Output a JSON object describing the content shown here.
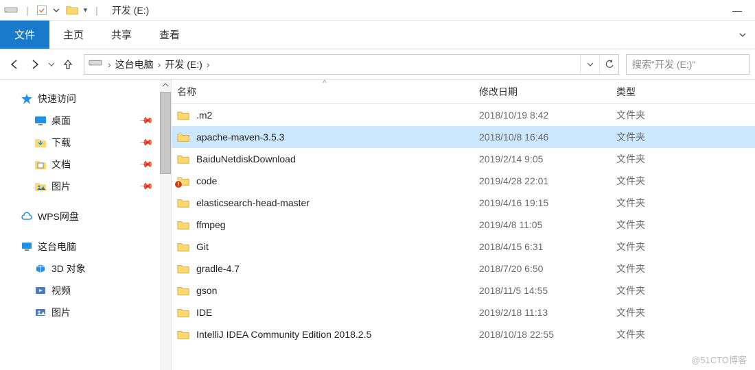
{
  "window": {
    "title": "开发 (E:)",
    "minimize": "—"
  },
  "ribbon": {
    "file": "文件",
    "home": "主页",
    "share": "共享",
    "view": "查看"
  },
  "breadcrumb": {
    "root": "这台电脑",
    "current": "开发 (E:)"
  },
  "search": {
    "placeholder": "搜索\"开发 (E:)\""
  },
  "sidebar": {
    "quick_access": "快速访问",
    "desktop": "桌面",
    "downloads": "下载",
    "documents": "文档",
    "pictures": "图片",
    "wps": "WPS网盘",
    "this_pc": "这台电脑",
    "objects3d": "3D 对象",
    "videos": "视频",
    "pictures2": "图片"
  },
  "columns": {
    "name": "名称",
    "date": "修改日期",
    "type": "类型"
  },
  "type_folder": "文件夹",
  "files": [
    {
      "name": ".m2",
      "date": "2018/10/19 8:42",
      "type": "文件夹",
      "selected": false,
      "overlay": false
    },
    {
      "name": "apache-maven-3.5.3",
      "date": "2018/10/8 16:46",
      "type": "文件夹",
      "selected": true,
      "overlay": false
    },
    {
      "name": "BaiduNetdiskDownload",
      "date": "2019/2/14 9:05",
      "type": "文件夹",
      "selected": false,
      "overlay": false
    },
    {
      "name": "code",
      "date": "2019/4/28 22:01",
      "type": "文件夹",
      "selected": false,
      "overlay": true
    },
    {
      "name": "elasticsearch-head-master",
      "date": "2019/4/16 19:15",
      "type": "文件夹",
      "selected": false,
      "overlay": false
    },
    {
      "name": "ffmpeg",
      "date": "2019/4/8 11:05",
      "type": "文件夹",
      "selected": false,
      "overlay": false
    },
    {
      "name": "Git",
      "date": "2018/4/15 6:31",
      "type": "文件夹",
      "selected": false,
      "overlay": false
    },
    {
      "name": "gradle-4.7",
      "date": "2018/7/20 6:50",
      "type": "文件夹",
      "selected": false,
      "overlay": false
    },
    {
      "name": "gson",
      "date": "2018/11/5 14:55",
      "type": "文件夹",
      "selected": false,
      "overlay": false
    },
    {
      "name": "IDE",
      "date": "2019/2/18 11:13",
      "type": "文件夹",
      "selected": false,
      "overlay": false
    },
    {
      "name": "IntelliJ IDEA Community Edition 2018.2.5",
      "date": "2018/10/18 22:55",
      "type": "文件夹",
      "selected": false,
      "overlay": false
    }
  ],
  "watermark": "@51CTO博客"
}
